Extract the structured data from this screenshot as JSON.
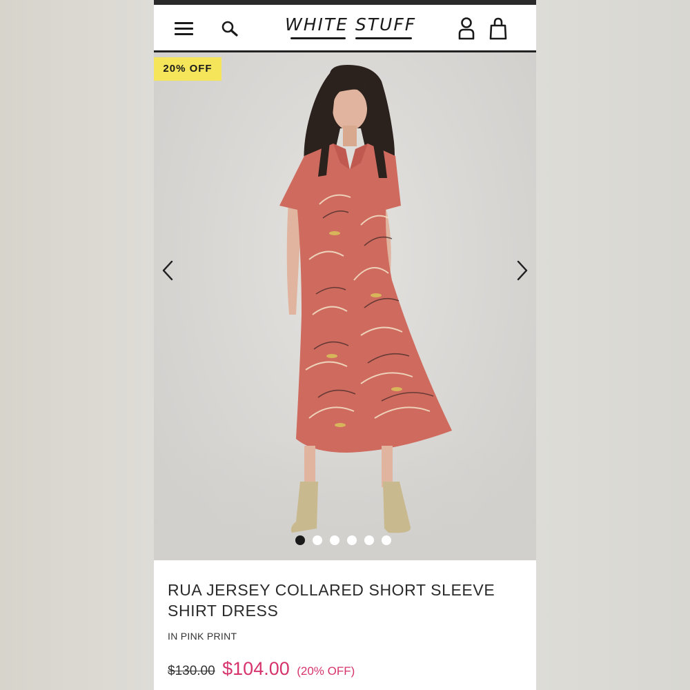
{
  "header": {
    "brand_word1": "WHITE",
    "brand_word2": "STUFF",
    "icons": [
      "menu-icon",
      "search-icon",
      "account-icon",
      "bag-icon"
    ]
  },
  "gallery": {
    "badge": "20% OFF",
    "image_count": 6,
    "active_index": 0
  },
  "product": {
    "title": "RUA JERSEY COLLARED SHORT SLEEVE SHIRT DRESS",
    "color_label": "IN PINK PRINT",
    "price_original": "$130.00",
    "price_sale": "$104.00",
    "discount_label": "(20% OFF)"
  },
  "colors": {
    "badge_bg": "#f4e55a",
    "sale_price": "#d6336c",
    "header_border": "#222222"
  }
}
